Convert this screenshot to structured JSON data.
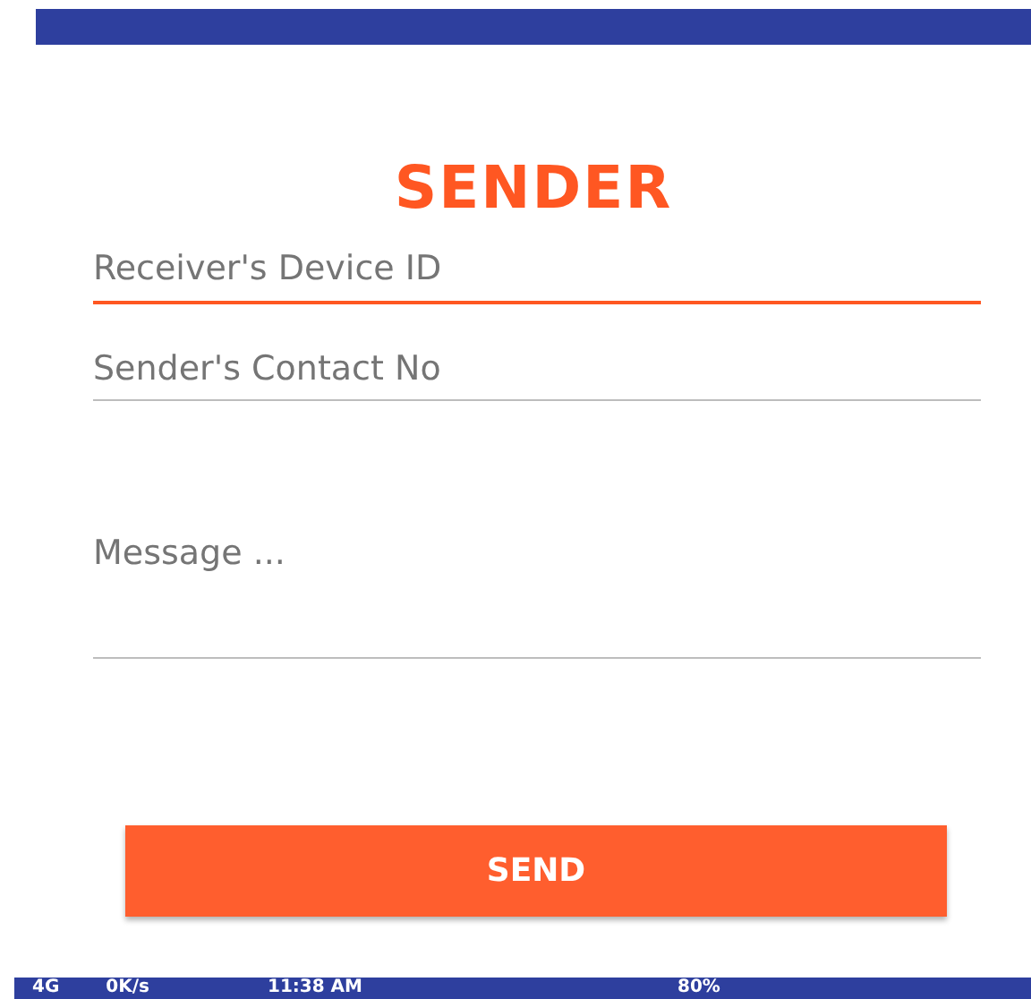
{
  "title": "SENDER",
  "fields": [
    {
      "placeholder": "Receiver's Device ID",
      "focused": true,
      "kind": "line"
    },
    {
      "placeholder": "Sender's Contact No",
      "focused": false,
      "kind": "line"
    },
    {
      "placeholder": "Message ...",
      "focused": false,
      "kind": "multiline"
    }
  ],
  "button": "SEND",
  "status_bar": {
    "network": "4G",
    "speed": "0K/s",
    "time": "11:38 AM",
    "battery": "80%"
  }
}
